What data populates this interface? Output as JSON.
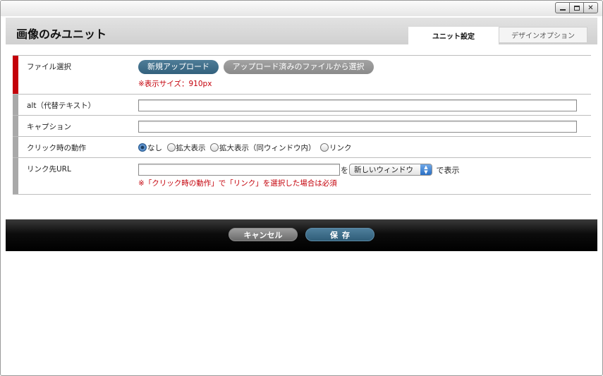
{
  "window": {
    "controls": {
      "minimize_label": "",
      "maximize_label": "",
      "close_label": "✕"
    }
  },
  "header": {
    "title": "画像のみユニット",
    "tabs": [
      {
        "label": "ユニット設定",
        "active": true
      },
      {
        "label": "デザインオプション",
        "active": false
      }
    ]
  },
  "form": {
    "file": {
      "label": "ファイル選択",
      "upload_button": "新規アップロード",
      "select_uploaded_button": "アップロード済みのファイルから選択",
      "note": "※表示サイズ：910px"
    },
    "alt": {
      "label": "alt（代替テキスト）",
      "value": ""
    },
    "caption": {
      "label": "キャプション",
      "value": ""
    },
    "click_action": {
      "label": "クリック時の動作",
      "options": [
        {
          "label": "なし",
          "checked": true
        },
        {
          "label": "拡大表示",
          "checked": false
        },
        {
          "label": "拡大表示（同ウィンドウ内）",
          "checked": false
        },
        {
          "label": "リンク",
          "checked": false
        }
      ]
    },
    "link_url": {
      "label": "リンク先URL",
      "value": "",
      "connector": "を",
      "target_selected": "新しいウィンドウ",
      "suffix": "で表示",
      "note": "※「クリック時の動作」で「リンク」を選択した場合は必須"
    }
  },
  "footer": {
    "cancel_label": "キャンセル",
    "save_label": "保存"
  },
  "colors": {
    "required_bar": "#c4000a",
    "optional_bar": "#a9a9a9",
    "accent_button": "#33617d",
    "note_text": "#c4000a"
  }
}
